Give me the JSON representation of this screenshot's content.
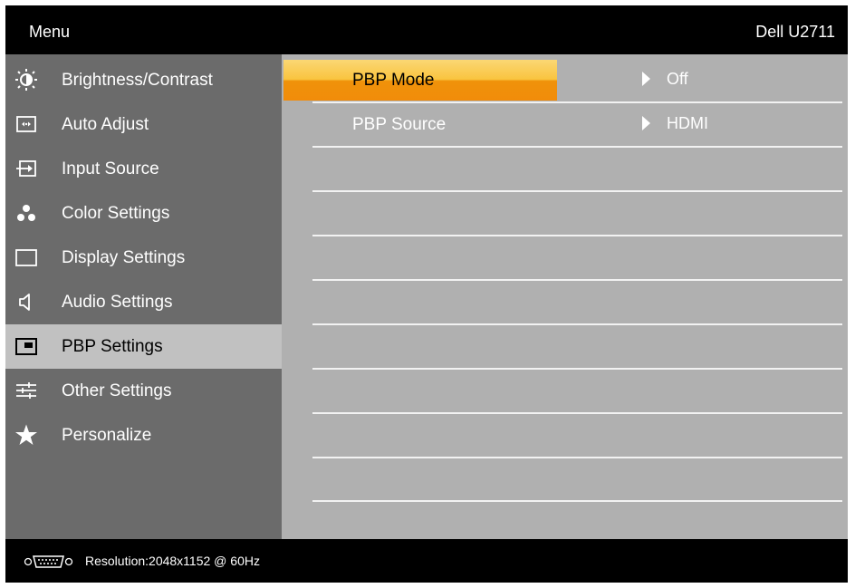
{
  "header": {
    "menu_title": "Menu",
    "model": "Dell U2711"
  },
  "sidebar": {
    "items": [
      {
        "label": "Brightness/Contrast",
        "icon": "brightness-icon"
      },
      {
        "label": "Auto Adjust",
        "icon": "auto-adjust-icon"
      },
      {
        "label": "Input Source",
        "icon": "input-source-icon"
      },
      {
        "label": "Color Settings",
        "icon": "color-settings-icon"
      },
      {
        "label": "Display Settings",
        "icon": "display-settings-icon"
      },
      {
        "label": "Audio Settings",
        "icon": "speaker-icon"
      },
      {
        "label": "PBP Settings",
        "icon": "pbp-icon",
        "selected": true
      },
      {
        "label": "Other Settings",
        "icon": "sliders-icon"
      },
      {
        "label": "Personalize",
        "icon": "star-icon"
      }
    ]
  },
  "panel": {
    "rows": [
      {
        "label": "PBP Mode",
        "value": "Off",
        "highlighted": true
      },
      {
        "label": "PBP Source",
        "value": "HDMI"
      }
    ]
  },
  "footer": {
    "connector_icon": "vga-connector-icon",
    "resolution": "Resolution:2048x1152 @ 60Hz"
  },
  "colors": {
    "highlight_top": "#fbd774",
    "highlight_bottom": "#f18c0a",
    "sidebar_bg": "#6b6b6b",
    "content_bg": "#b0b0b0",
    "selected_bg": "#c1c1c1"
  }
}
